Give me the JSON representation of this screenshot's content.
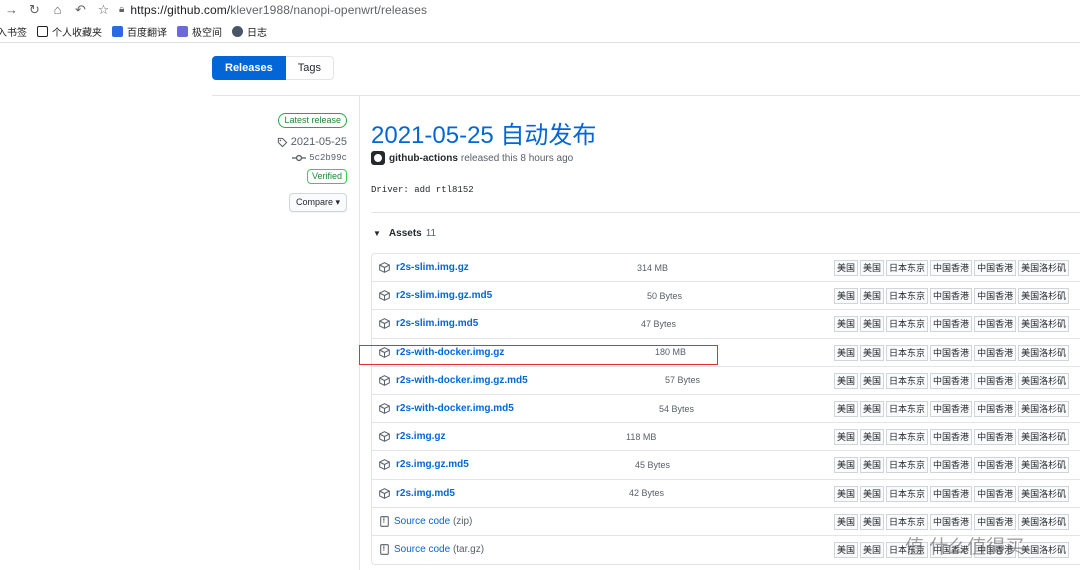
{
  "browser": {
    "url_main": "https://github.com/",
    "url_path": "klever1988/nanopi-openwrt/releases",
    "bookmarks": [
      {
        "label": "入书签",
        "color": "#ffffff"
      },
      {
        "label": "个人收藏夹",
        "color": "#202124"
      },
      {
        "label": "百度翻译",
        "color": "#2b6ae0"
      },
      {
        "label": "极空间",
        "color": "#6c6ad6"
      },
      {
        "label": "日志",
        "color": "#4a5568"
      }
    ]
  },
  "subnav": {
    "releases": "Releases",
    "tags": "Tags"
  },
  "sidebar": {
    "latest_badge": "Latest release",
    "tag": "2021-05-25",
    "commit": "5c2b99c",
    "verified": "Verified",
    "compare": "Compare ▾"
  },
  "release": {
    "title": "2021-05-25 自动发布",
    "author": "github-actions",
    "released_text": "released this 8 hours ago",
    "body": "Driver: add rtl8152"
  },
  "assets": {
    "label": "Assets",
    "count": "11",
    "mirrors": [
      "美国",
      "美国",
      "日本东京",
      "中国香港",
      "中国香港",
      "美国洛杉矶"
    ],
    "items": [
      {
        "name": "r2s-slim.img.gz",
        "size": "314 MB",
        "icon": "package-icon"
      },
      {
        "name": "r2s-slim.img.gz.md5",
        "size": "50 Bytes",
        "icon": "package-icon"
      },
      {
        "name": "r2s-slim.img.md5",
        "size": "47 Bytes",
        "icon": "package-icon"
      },
      {
        "name": "r2s-with-docker.img.gz",
        "size": "180 MB",
        "icon": "package-icon"
      },
      {
        "name": "r2s-with-docker.img.gz.md5",
        "size": "57 Bytes",
        "icon": "package-icon"
      },
      {
        "name": "r2s-with-docker.img.md5",
        "size": "54 Bytes",
        "icon": "package-icon"
      },
      {
        "name": "r2s.img.gz",
        "size": "118 MB",
        "icon": "package-icon"
      },
      {
        "name": "r2s.img.gz.md5",
        "size": "45 Bytes",
        "icon": "package-icon"
      },
      {
        "name": "r2s.img.md5",
        "size": "42 Bytes",
        "icon": "package-icon"
      },
      {
        "name": "Source code",
        "ext": "(zip)",
        "icon": "file-zip-icon"
      },
      {
        "name": "Source code",
        "ext": "(tar.gz)",
        "icon": "file-zip-icon"
      }
    ]
  },
  "watermark": "值 什么值得买"
}
